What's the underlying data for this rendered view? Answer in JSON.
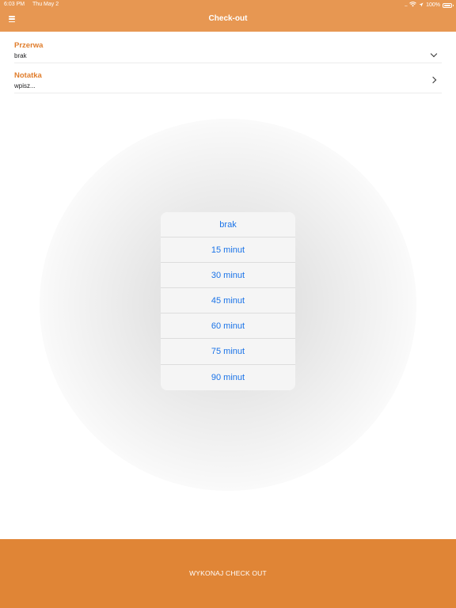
{
  "status_bar": {
    "time": "6:03 PM",
    "date": "Thu May 2",
    "signal_dots": ".....",
    "wifi_icon": "wifi-icon",
    "location_icon": "location-arrow-icon",
    "battery_percent": "100%"
  },
  "header": {
    "title": "Check-out",
    "menu_icon": "hamburger-menu-icon",
    "background_color": "#E79752"
  },
  "form": {
    "break": {
      "label": "Przerwa",
      "value": "brak",
      "icon": "chevron-down-icon"
    },
    "note": {
      "label": "Notatka",
      "placeholder": "wpisz...",
      "icon": "chevron-right-icon"
    },
    "label_color": "#E07D2C"
  },
  "picker": {
    "options": [
      "brak",
      "15 minut",
      "30 minut",
      "45 minut",
      "60 minut",
      "75 minut",
      "90 minut"
    ],
    "option_color": "#1A73E8"
  },
  "footer": {
    "checkout_label": "WYKONAJ CHECK OUT",
    "background_color": "#E08536"
  }
}
